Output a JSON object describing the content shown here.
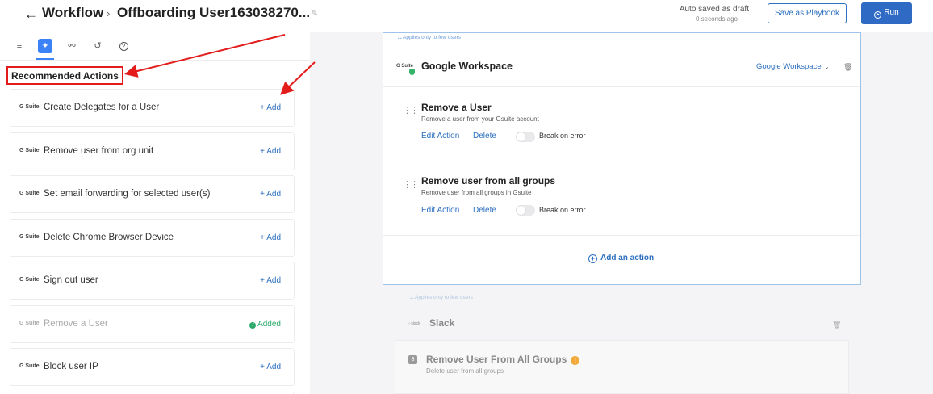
{
  "header": {
    "back_icon": "arrow-left-icon",
    "title_root": "Workflow",
    "separator": "›",
    "title_name": "Offboarding User163038270...",
    "edit_icon": "pencil-icon",
    "autosave_status": "Auto saved as draft",
    "autosave_time": "0 seconds ago",
    "save_playbook_label": "Save as Playbook",
    "run_label": "Run",
    "run_icon": "play-circle-icon"
  },
  "left_panel": {
    "tabs": [
      {
        "icon": "list-icon",
        "glyph": "≡"
      },
      {
        "icon": "sparkle-icon",
        "glyph": "✦"
      },
      {
        "icon": "link-icon",
        "glyph": "⚯"
      },
      {
        "icon": "history-icon",
        "glyph": "↺"
      },
      {
        "icon": "help-icon",
        "glyph": "?"
      }
    ],
    "heading": "Recommended Actions",
    "items": [
      {
        "app": "G Suite",
        "label": "Create Delegates for a User",
        "action": "+ Add",
        "added": false
      },
      {
        "app": "G Suite",
        "label": "Remove user from org unit",
        "action": "+ Add",
        "added": false
      },
      {
        "app": "G Suite",
        "label": "Set email forwarding for selected user(s)",
        "action": "+ Add",
        "added": false
      },
      {
        "app": "G Suite",
        "label": "Delete Chrome Browser Device",
        "action": "+ Add",
        "added": false
      },
      {
        "app": "G Suite",
        "label": "Sign out user",
        "action": "+ Add",
        "added": false
      },
      {
        "app": "G Suite",
        "label": "Remove a User",
        "action": "Added",
        "added": true
      },
      {
        "app": "G Suite",
        "label": "Block user IP",
        "action": "+ Add",
        "added": false
      }
    ]
  },
  "workspace_panel": {
    "applies_note": "Applies only to few users",
    "logo_text": "G Suite",
    "title": "Google Workspace",
    "selector_value": "Google Workspace",
    "actions": [
      {
        "title": "Remove a User",
        "subtitle": "Remove a user from your Gsuite account",
        "edit": "Edit Action",
        "delete": "Delete",
        "break_label": "Break on error"
      },
      {
        "title": "Remove user from all groups",
        "subtitle": "Remove user from all groups in Gsuite",
        "edit": "Edit Action",
        "delete": "Delete",
        "break_label": "Break on error"
      }
    ],
    "add_action_label": "Add an action"
  },
  "slack_panel": {
    "applies_note": "Applies only to few users",
    "logo_text": "slack",
    "title": "Slack",
    "step_number": "3",
    "action_title": "Remove User From All Groups",
    "action_subtitle": "Delete user from all groups"
  },
  "colors": {
    "primary": "#2f6bc4",
    "link": "#2c6fbf",
    "annotation_red": "#e31b1b",
    "added_green": "#2aa86a",
    "warning": "#f3a93a"
  }
}
